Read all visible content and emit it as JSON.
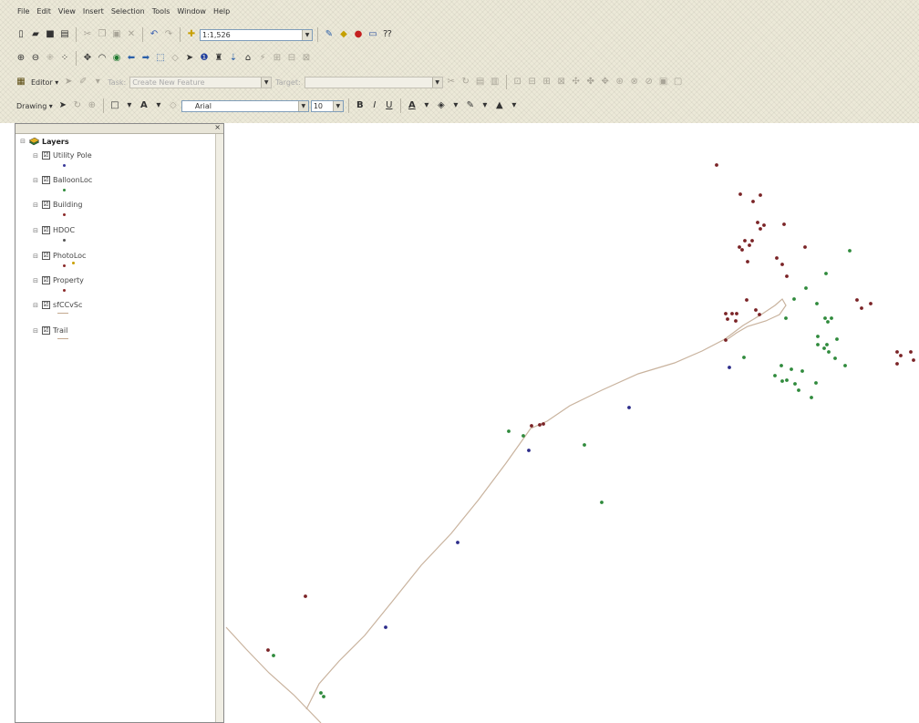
{
  "menu": [
    "File",
    "Edit",
    "View",
    "Insert",
    "Selection",
    "Tools",
    "Window",
    "Help"
  ],
  "standard_toolbar": {
    "scale_value": "1:1,526"
  },
  "tools_toolbar": {},
  "editor_toolbar": {
    "editor_label": "Editor ▾",
    "task_label": "Task:",
    "task_value": "Create New Feature",
    "target_label": "Target:",
    "target_value": ""
  },
  "drawing_toolbar": {
    "drawing_label": "Drawing ▾",
    "font_value": "Arial",
    "size_value": "10",
    "bold": "B",
    "italic": "I",
    "underline": "U"
  },
  "toc": {
    "root_label": "Layers",
    "layers": [
      {
        "label": "Utility Pole",
        "checked": "☑",
        "color": "#3a3a9a"
      },
      {
        "label": "BalloonLoc",
        "checked": "☑",
        "color": "#2e8b3a"
      },
      {
        "label": "Building",
        "checked": "☑",
        "color": "#8b2a2a"
      },
      {
        "label": "HDOC",
        "checked": "☑",
        "color": "#555555"
      },
      {
        "label": "PhotoLoc",
        "checked": "☑",
        "color": "#8b2a2a"
      },
      {
        "label": "Property",
        "checked": "☑",
        "color": "#8b2a2a"
      },
      {
        "label": "sfCCvSc",
        "checked": "☑",
        "color": "#c4a98f"
      },
      {
        "label": "Trail",
        "checked": "☑",
        "color": "#c4a98f"
      }
    ]
  },
  "map": {
    "colors": {
      "maroon": "#7a2326",
      "green": "#2f8a3c",
      "blue": "#2c2c8a",
      "trail": "#c9b39e"
    }
  }
}
